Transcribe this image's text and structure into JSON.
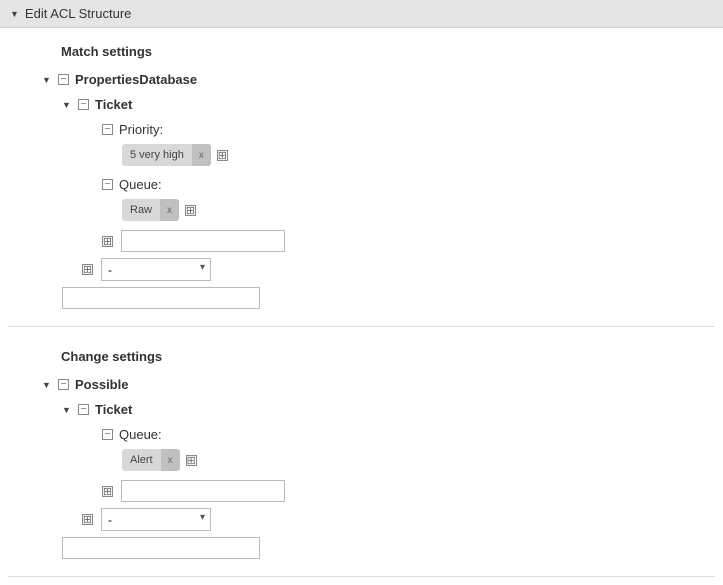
{
  "header": {
    "title": "Edit ACL Structure"
  },
  "match": {
    "title": "Match settings",
    "root": {
      "label": "PropertiesDatabase",
      "ticket": {
        "label": "Ticket",
        "priority": {
          "label": "Priority:",
          "tag": {
            "text": "5 very high"
          }
        },
        "queue": {
          "label": "Queue:",
          "tag": {
            "text": "Raw"
          }
        }
      }
    },
    "select_value": "-"
  },
  "change": {
    "title": "Change settings",
    "root": {
      "label": "Possible",
      "ticket": {
        "label": "Ticket",
        "queue": {
          "label": "Queue:",
          "tag": {
            "text": "Alert"
          }
        }
      }
    },
    "select_value": "-"
  },
  "remove_label": "x"
}
